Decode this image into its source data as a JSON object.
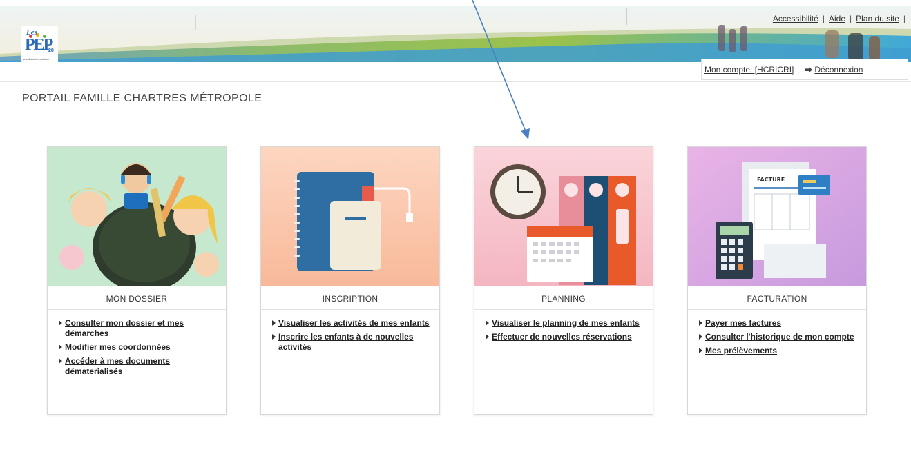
{
  "header": {
    "logo": {
      "brand_small": "Les",
      "brand": "PEP",
      "number": "28",
      "tagline": "la solidarité en action"
    },
    "links": [
      {
        "label": "Accessibilité"
      },
      {
        "label": "Aide"
      },
      {
        "label": "Plan du site"
      }
    ],
    "separator": "|",
    "account_label": "Mon compte: [HCRICRI]",
    "logout_label": "Déconnexion"
  },
  "page": {
    "title": "PORTAIL FAMILLE CHARTRES MÉTROPOLE"
  },
  "cards": [
    {
      "title": "MON DOSSIER",
      "links": [
        "Consulter mon dossier et mes démarches",
        "Modifier mes coordonnées",
        "Accéder à mes documents dématerialisés"
      ]
    },
    {
      "title": "INSCRIPTION",
      "links": [
        "Visualiser les activités de mes enfants",
        "Inscrire les enfants à de nouvelles activités"
      ]
    },
    {
      "title": "PLANNING",
      "links": [
        "Visualiser le planning de mes enfants",
        "Effectuer de nouvelles réservations"
      ]
    },
    {
      "title": "FACTURATION",
      "links": [
        "Payer mes factures",
        "Consulter l'historique de mon compte",
        "Mes prélèvements"
      ],
      "invoice_text": "FACTURE"
    }
  ],
  "colors": {
    "card1_bg": "#bfe4c9",
    "card2_bg": "#f9c3a7",
    "card3_bg": "#f7c6cf",
    "card4_bg": "#d7a8e6",
    "annotation_arrow": "#4a7fc1"
  }
}
